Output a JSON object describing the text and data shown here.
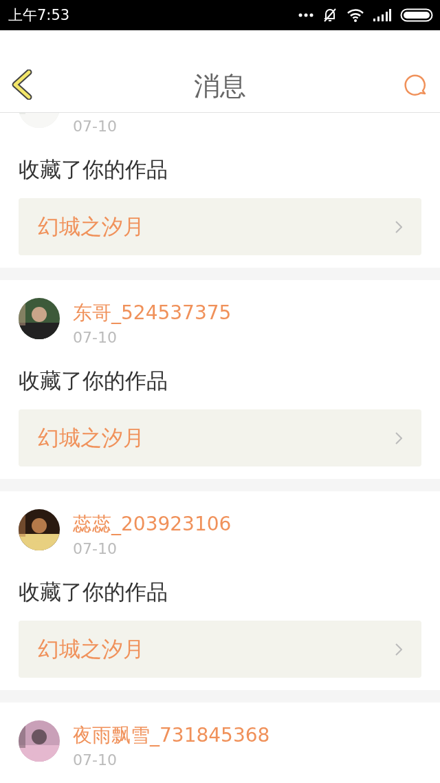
{
  "status_bar": {
    "time": "上午7:53"
  },
  "header": {
    "title": "消息"
  },
  "messages": [
    {
      "date": "07-10",
      "action": "收藏了你的作品",
      "work": "幻城之汐月"
    },
    {
      "name": "东哥_524537375",
      "date": "07-10",
      "action": "收藏了你的作品",
      "work": "幻城之汐月"
    },
    {
      "name": "蕊蕊_203923106",
      "date": "07-10",
      "action": "收藏了你的作品",
      "work": "幻城之汐月"
    },
    {
      "name": "夜雨飘雪_731845368",
      "date": "07-10"
    }
  ]
}
